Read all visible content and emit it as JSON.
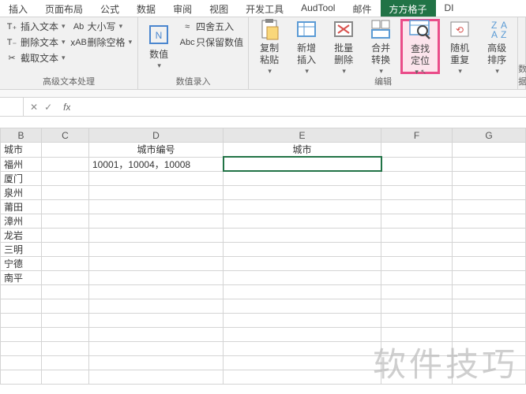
{
  "tabs": [
    "插入",
    "页面布局",
    "公式",
    "数据",
    "审阅",
    "视图",
    "开发工具",
    "AudTool",
    "邮件",
    "方方格子",
    "DI"
  ],
  "activeTab": 9,
  "ribbon": {
    "g1": {
      "items": [
        "插入文本",
        "删除文本",
        "截取文本"
      ],
      "col2": [
        "大小写",
        "删除空格"
      ],
      "label": "高级文本处理"
    },
    "g2": {
      "main": "数值",
      "items": [
        "四舍五入",
        "只保留数值"
      ],
      "label": "数值录入"
    },
    "g3": {
      "btns": [
        "复制粘贴",
        "新增插入",
        "批量删除",
        "合并转换",
        "查找定位",
        "随机重复",
        "高级排序"
      ],
      "label": "编辑"
    },
    "g4": {
      "label": "数据"
    }
  },
  "cells": {
    "hdr": [
      "B",
      "C",
      "D",
      "E",
      "F",
      "G"
    ],
    "rows": [
      {
        "b": "城市",
        "d": "城市编号",
        "e": "城市"
      },
      {
        "b": "福州",
        "d": "10001，10004，10008"
      },
      {
        "b": "厦门"
      },
      {
        "b": "泉州"
      },
      {
        "b": "莆田"
      },
      {
        "b": "漳州"
      },
      {
        "b": "龙岩"
      },
      {
        "b": "三明"
      },
      {
        "b": "宁德"
      },
      {
        "b": "南平"
      }
    ]
  },
  "watermark": "软件技巧"
}
